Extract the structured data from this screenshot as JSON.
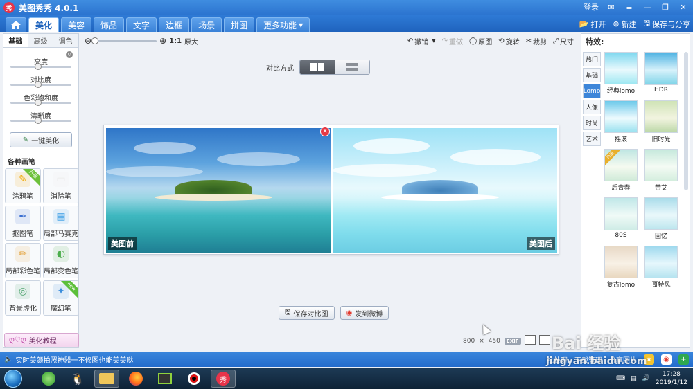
{
  "titlebar": {
    "logo_text": "秀",
    "title": "美图秀秀 4.0.1",
    "login": "登录"
  },
  "menu": {
    "tabs": [
      {
        "label": "美化"
      },
      {
        "label": "美容"
      },
      {
        "label": "饰品"
      },
      {
        "label": "文字"
      },
      {
        "label": "边框"
      },
      {
        "label": "场景"
      },
      {
        "label": "拼图"
      },
      {
        "label": "更多功能"
      }
    ],
    "open": "打开",
    "new": "新建",
    "save_share": "保存与分享"
  },
  "left": {
    "subtabs": [
      "基础",
      "高级",
      "调色"
    ],
    "sliders": [
      {
        "label": "亮度",
        "value": 0.45
      },
      {
        "label": "对比度",
        "value": 0.45
      },
      {
        "label": "色彩饱和度",
        "value": 0.45
      },
      {
        "label": "清晰度",
        "value": 0.45
      }
    ],
    "one_key": "一键美化",
    "brushes_title": "各种画笔",
    "brushes": [
      {
        "label": "涂鸦笔",
        "badge": "升级"
      },
      {
        "label": "消除笔",
        "badge": ""
      },
      {
        "label": "抠图笔",
        "badge": ""
      },
      {
        "label": "局部马赛克",
        "badge": ""
      },
      {
        "label": "局部彩色笔",
        "badge": ""
      },
      {
        "label": "局部变色笔",
        "badge": ""
      },
      {
        "label": "背景虚化",
        "badge": ""
      },
      {
        "label": "魔幻笔",
        "badge": "new"
      }
    ],
    "tutorial": "美化教程"
  },
  "toolbar": {
    "zoom_value": 0.0,
    "ratio": "1:1",
    "original_size": "原大",
    "undo": "撤销",
    "redo": "重做",
    "original": "原图",
    "rotate": "旋转",
    "crop": "裁剪",
    "size": "尺寸"
  },
  "compare": {
    "label": "对比方式"
  },
  "photos": {
    "before_label": "美图前",
    "after_label": "美图后"
  },
  "actions": {
    "save_compare": "保存对比图",
    "send_weibo": "发到微博"
  },
  "image_info": {
    "width": "800",
    "times": "×",
    "height": "450",
    "exif": "EXIF"
  },
  "effects": {
    "title": "特效:",
    "categories": [
      "热门",
      "基础",
      "Lomo",
      "人像",
      "时尚",
      "艺术"
    ],
    "items": [
      {
        "name": "经典lomo",
        "badge": ""
      },
      {
        "name": "HDR",
        "badge": ""
      },
      {
        "name": "摇滚",
        "badge": ""
      },
      {
        "name": "旧时光",
        "badge": ""
      },
      {
        "name": "后青春",
        "badge": "升级"
      },
      {
        "name": "苦艾",
        "badge": ""
      },
      {
        "name": "80S",
        "badge": ""
      },
      {
        "name": "回忆",
        "badge": ""
      },
      {
        "name": "复古lomo",
        "badge": ""
      },
      {
        "name": "哥特风",
        "badge": ""
      }
    ]
  },
  "status": {
    "message": "实时美颜拍照神器一不修图也能美美哒",
    "batch": "批处理",
    "download": "下载管理",
    "share": "分享图片"
  },
  "taskbar": {
    "time": "17:28",
    "date": "2019/1/12"
  },
  "watermark": {
    "text": "Bai 经验",
    "site": "jingyan.baidu.com"
  },
  "colors": {
    "accent": "#2b73cf",
    "close": "#e53845"
  }
}
